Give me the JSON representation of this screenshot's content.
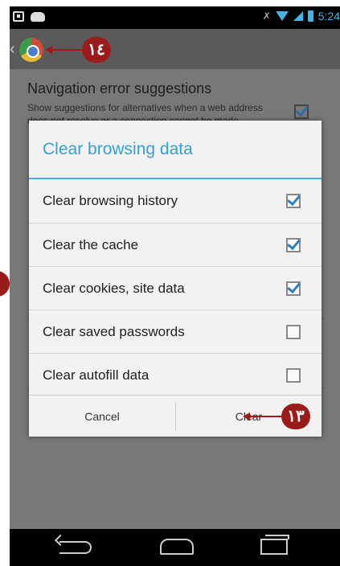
{
  "status_bar": {
    "time": "5:24",
    "colors": {
      "accent": "#3fb4e5"
    }
  },
  "action_bar": {
    "title": ""
  },
  "callouts": {
    "top": "١٤",
    "clear": "١٣",
    "left": ""
  },
  "background_setting": {
    "title": "Navigation error suggestions",
    "subtitle": "Show suggestions for alternatives when a web address does not resolve or a connection cannot be made.",
    "checked": true
  },
  "dialog": {
    "title": "Clear browsing data",
    "options": [
      {
        "label": "Clear browsing history",
        "checked": true
      },
      {
        "label": "Clear the cache",
        "checked": true
      },
      {
        "label": "Clear cookies, site data",
        "checked": true
      },
      {
        "label": "Clear saved passwords",
        "checked": false
      },
      {
        "label": "Clear autofill data",
        "checked": false
      }
    ],
    "buttons": {
      "cancel": "Cancel",
      "clear": "Clear"
    }
  },
  "nav_bar": {
    "icons": [
      "back-icon",
      "home-icon",
      "recent-apps-icon"
    ]
  }
}
